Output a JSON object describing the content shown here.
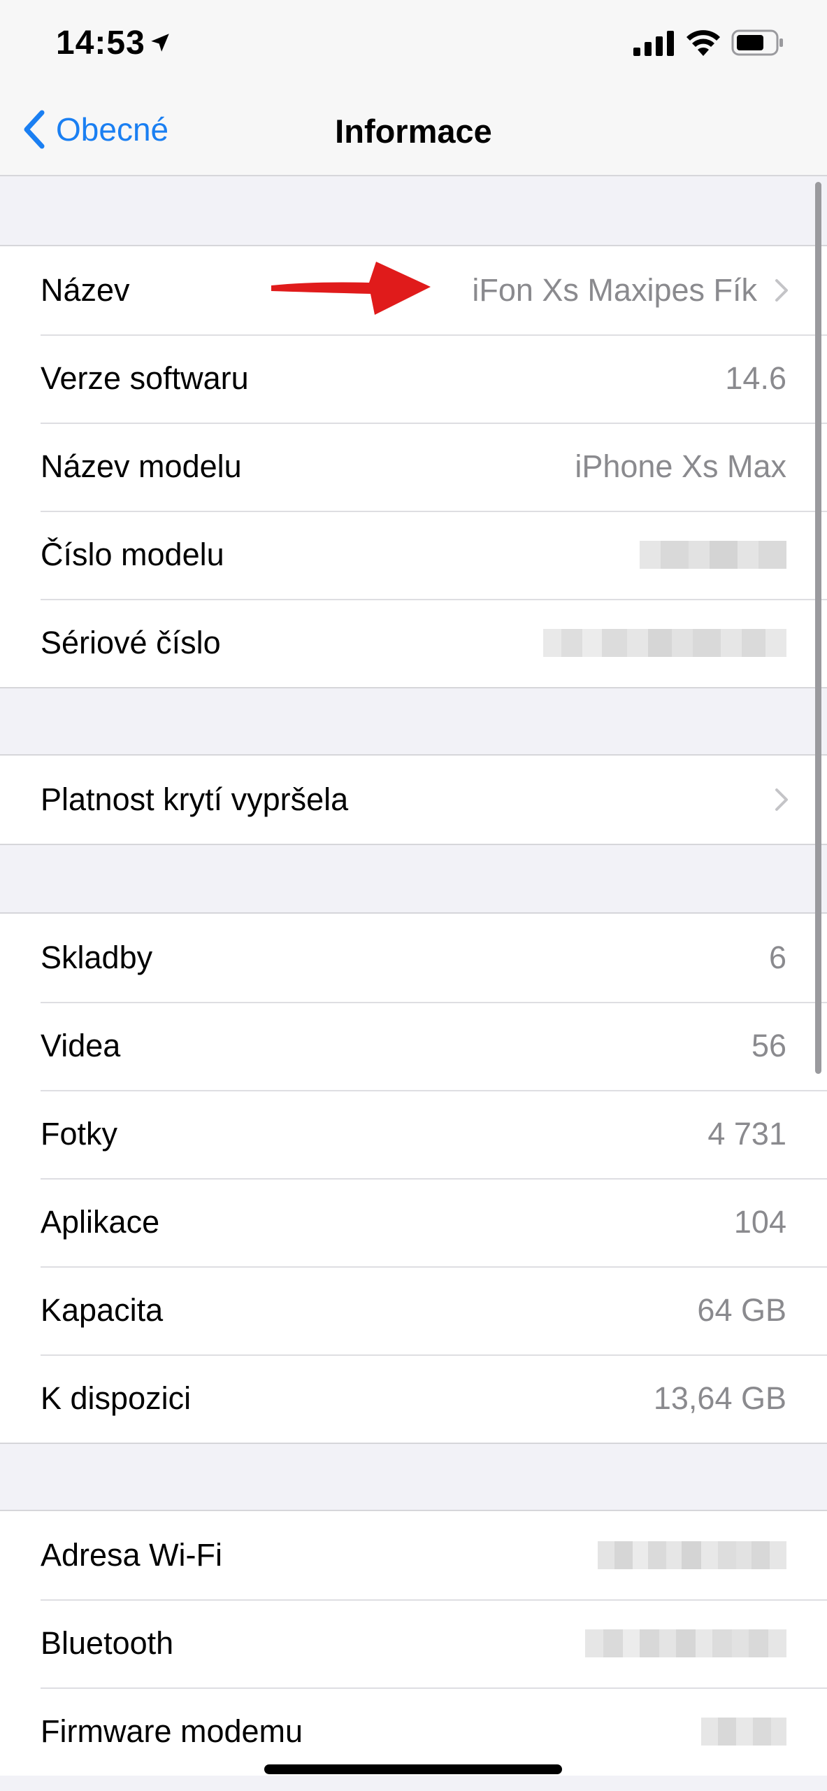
{
  "status_bar": {
    "time": "14:53"
  },
  "nav": {
    "back_label": "Obecné",
    "title": "Informace"
  },
  "groups": {
    "device": [
      {
        "label": "Název",
        "value": "iFon Xs Maxipes Fík"
      },
      {
        "label": "Verze softwaru",
        "value": "14.6"
      },
      {
        "label": "Název modelu",
        "value": "iPhone Xs Max"
      },
      {
        "label": "Číslo modelu"
      },
      {
        "label": "Sériové číslo"
      }
    ],
    "coverage": [
      {
        "label": "Platnost krytí vypršela"
      }
    ],
    "media": [
      {
        "label": "Skladby",
        "value": "6"
      },
      {
        "label": "Videa",
        "value": "56"
      },
      {
        "label": "Fotky",
        "value": "4 731"
      },
      {
        "label": "Aplikace",
        "value": "104"
      },
      {
        "label": "Kapacita",
        "value": "64 GB"
      },
      {
        "label": "K dispozici",
        "value": "13,64 GB"
      }
    ],
    "network": [
      {
        "label": "Adresa Wi-Fi"
      },
      {
        "label": "Bluetooth"
      },
      {
        "label": "Firmware modemu"
      }
    ]
  },
  "icons": {
    "back": "chevron-left-icon",
    "location": "location-arrow-icon",
    "signal": "cellular-signal-icon",
    "wifi": "wifi-icon",
    "battery": "battery-icon",
    "disclosure": "chevron-right-icon",
    "annotation": "red-arrow-icon"
  },
  "colors": {
    "accent": "#1a7ff2",
    "annotation": "#e01b1b",
    "secondary_text": "#8a8a8e"
  }
}
